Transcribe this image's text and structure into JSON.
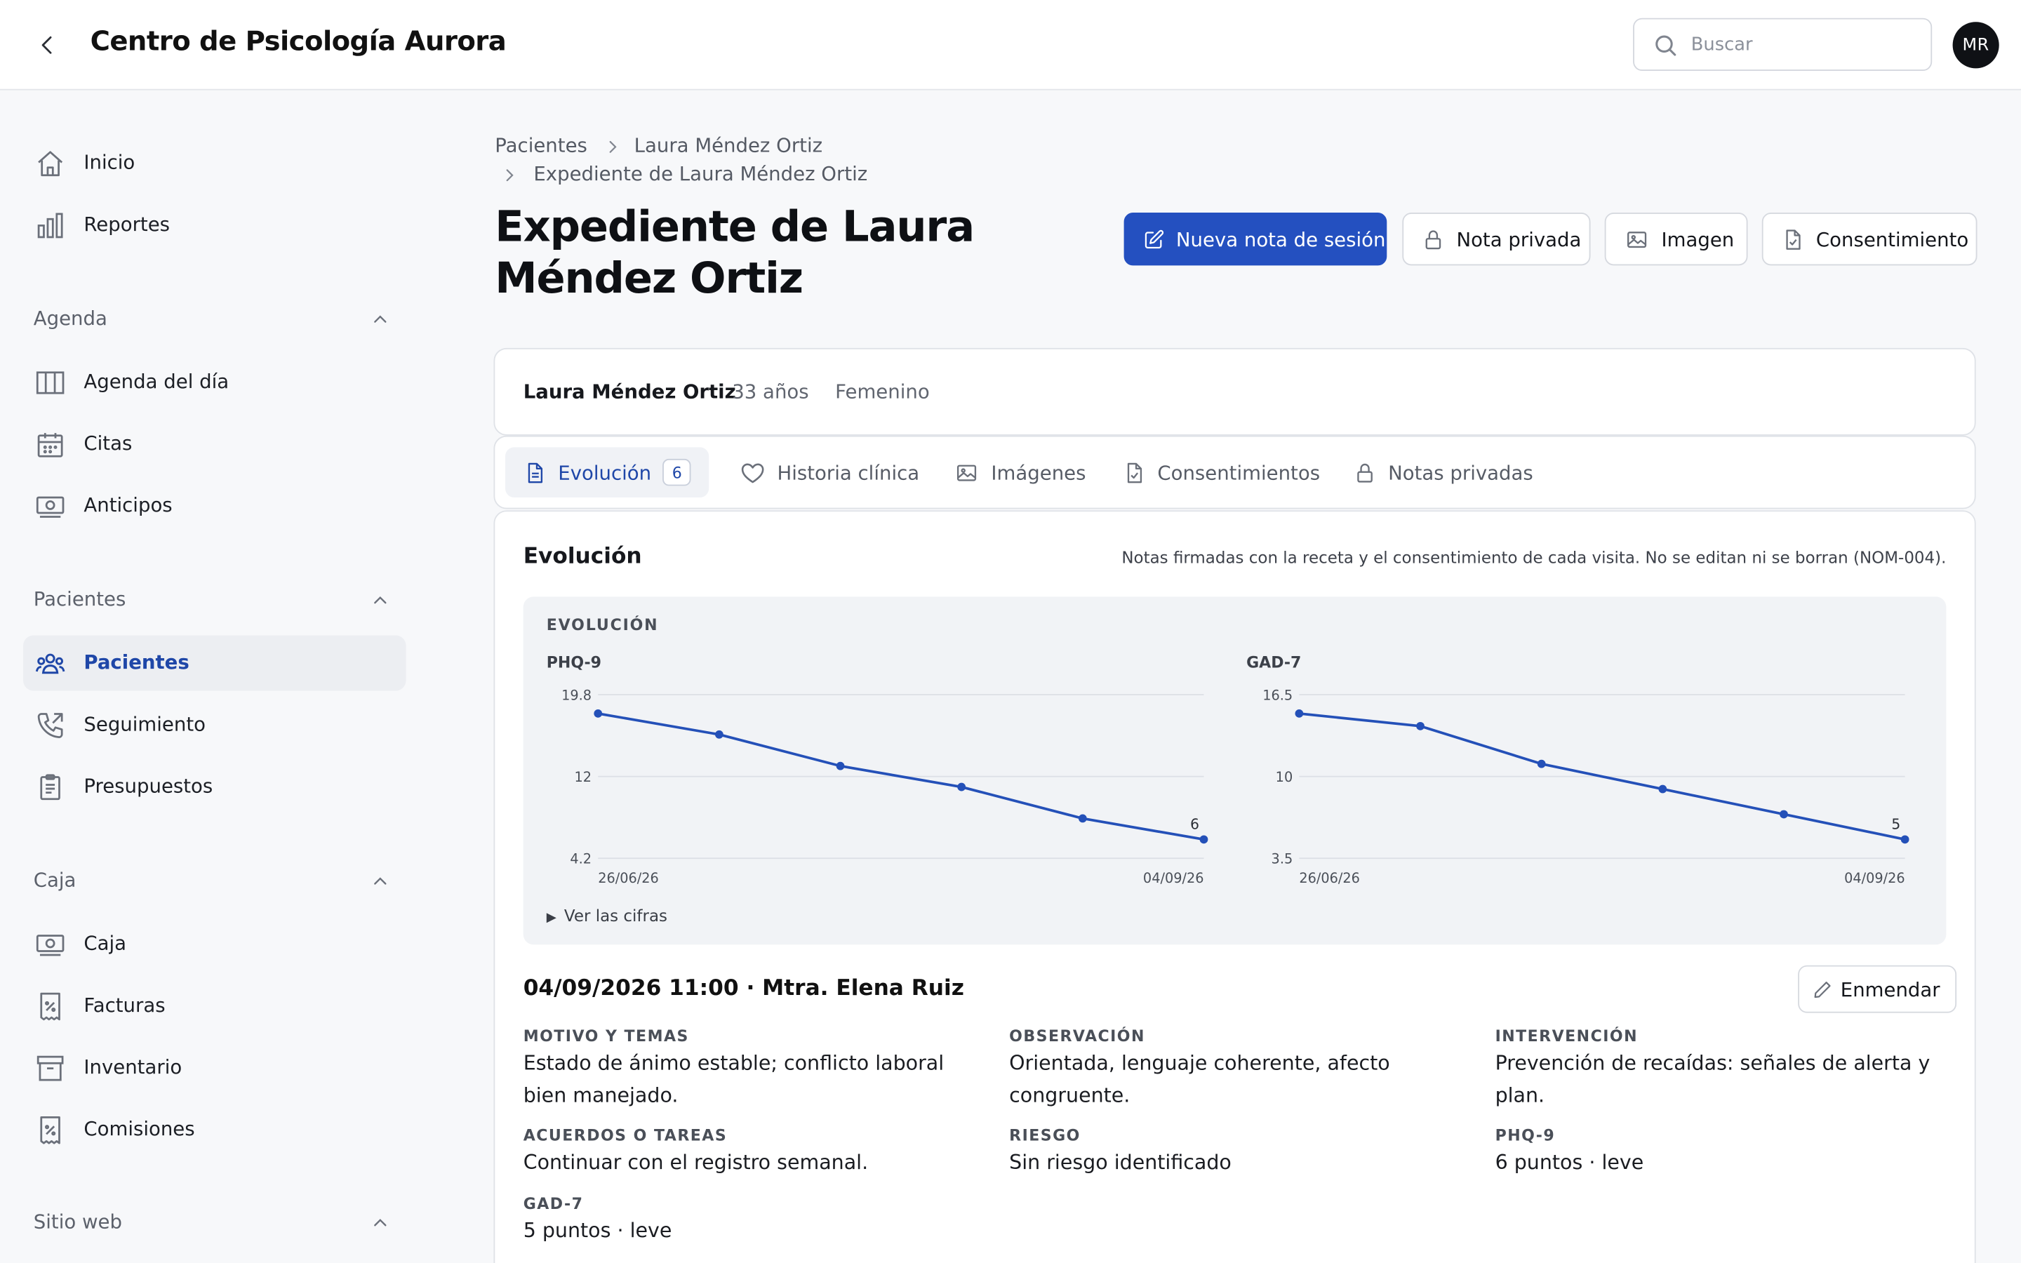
{
  "app": {
    "title": "Centro de Psicología Aurora",
    "search_placeholder": "Buscar",
    "avatar_initials": "MR"
  },
  "sidebar": {
    "top_items": [
      {
        "label": "Inicio",
        "icon": "home-icon"
      },
      {
        "label": "Reportes",
        "icon": "bar-chart-icon"
      }
    ],
    "sections": [
      {
        "title": "Agenda",
        "items": [
          {
            "label": "Agenda del día",
            "icon": "columns-icon"
          },
          {
            "label": "Citas",
            "icon": "calendar-icon"
          },
          {
            "label": "Anticipos",
            "icon": "money-icon"
          }
        ]
      },
      {
        "title": "Pacientes",
        "items": [
          {
            "label": "Pacientes",
            "icon": "users-icon",
            "active": true
          },
          {
            "label": "Seguimiento",
            "icon": "phone-icon"
          },
          {
            "label": "Presupuestos",
            "icon": "clipboard-icon"
          }
        ]
      },
      {
        "title": "Caja",
        "items": [
          {
            "label": "Caja",
            "icon": "money-icon"
          },
          {
            "label": "Facturas",
            "icon": "receipt-percent-icon"
          },
          {
            "label": "Inventario",
            "icon": "archive-icon"
          },
          {
            "label": "Comisiones",
            "icon": "receipt-percent-icon"
          }
        ]
      },
      {
        "title": "Sitio web",
        "items": []
      }
    ]
  },
  "breadcrumb": [
    "Pacientes",
    "Laura Méndez Ortiz",
    "Expediente de Laura Méndez Ortiz"
  ],
  "page": {
    "title": "Expediente de Laura Méndez Ortiz",
    "actions": {
      "new_note": "Nueva nota de sesión",
      "private_note": "Nota privada",
      "image": "Imagen",
      "consent": "Consentimiento"
    }
  },
  "patient": {
    "name": "Laura Méndez Ortiz",
    "age": "33 años",
    "sex": "Femenino"
  },
  "tabs": [
    {
      "label": "Evolución",
      "count": "6",
      "active": true,
      "icon": "document-icon"
    },
    {
      "label": "Historia clínica",
      "icon": "heart-icon"
    },
    {
      "label": "Imágenes",
      "icon": "image-icon"
    },
    {
      "label": "Consentimientos",
      "icon": "file-check-icon"
    },
    {
      "label": "Notas privadas",
      "icon": "lock-icon"
    }
  ],
  "evolution": {
    "title": "Evolución",
    "note": "Notas firmadas con la receta y el consentimiento de cada visita. No se editan ni se borran (NOM-004).",
    "chart_caption": "EVOLUCIÓN",
    "toggle_label": "Ver las cifras"
  },
  "chart_data": [
    {
      "type": "line",
      "title": "PHQ-9",
      "x_first_label": "26/06/26",
      "x_last_label": "04/09/26",
      "y_ticks": [
        "19.8",
        "12",
        "4.2"
      ],
      "ylim": [
        4.2,
        19.8
      ],
      "values": [
        18,
        16,
        13,
        11,
        8,
        6
      ],
      "last_value_label": "6",
      "color": "#2450b8"
    },
    {
      "type": "line",
      "title": "GAD-7",
      "x_first_label": "26/06/26",
      "x_last_label": "04/09/26",
      "y_ticks": [
        "16.5",
        "10",
        "3.5"
      ],
      "ylim": [
        3.5,
        16.5
      ],
      "values": [
        15,
        14,
        11,
        9,
        7,
        5
      ],
      "last_value_label": "5",
      "color": "#2450b8"
    }
  ],
  "entry": {
    "header": "04/09/2026 11:00 · Mtra. Elena Ruiz",
    "amend_label": "Enmendar",
    "fields": [
      {
        "label": "MOTIVO Y TEMAS",
        "value": "Estado de ánimo estable; conflicto laboral bien manejado."
      },
      {
        "label": "OBSERVACIÓN",
        "value": "Orientada, lenguaje coherente, afecto congruente."
      },
      {
        "label": "INTERVENCIÓN",
        "value": "Prevención de recaídas: señales de alerta y plan."
      },
      {
        "label": "ACUERDOS O TAREAS",
        "value": "Continuar con el registro semanal."
      },
      {
        "label": "RIESGO",
        "value": "Sin riesgo identificado"
      },
      {
        "label": "PHQ-9",
        "value": "6 puntos · leve"
      },
      {
        "label": "GAD-7",
        "value": "5 puntos · leve"
      }
    ]
  }
}
